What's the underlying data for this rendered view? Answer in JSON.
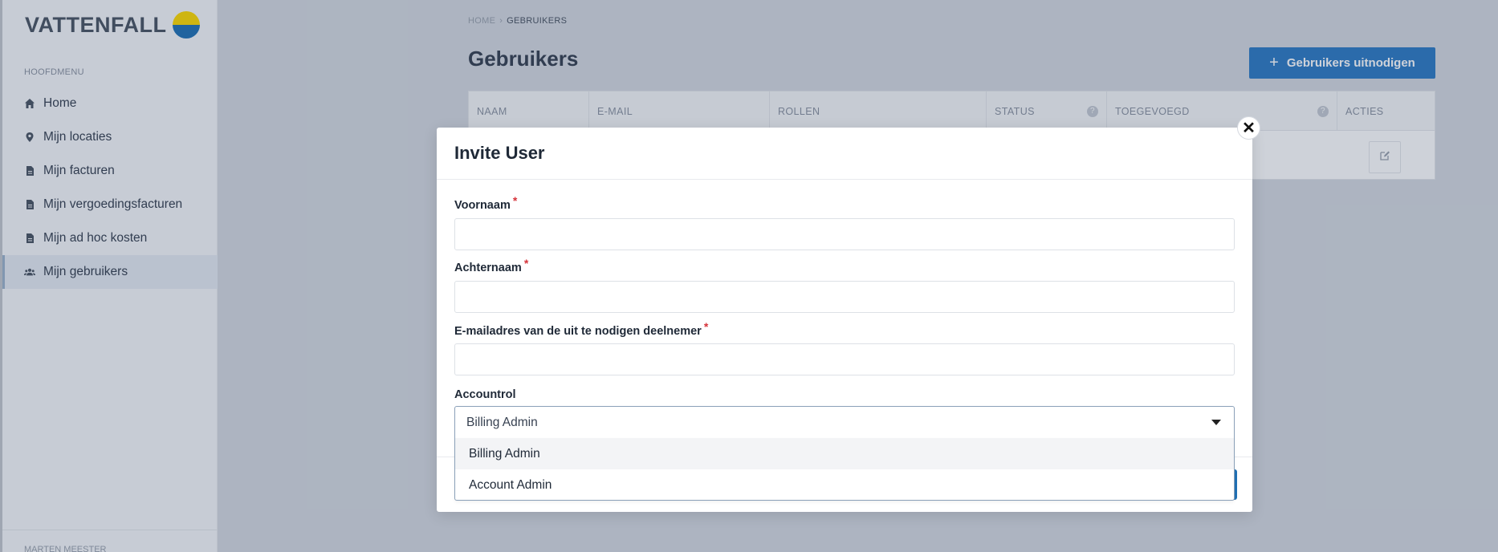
{
  "brand": {
    "name": "VATTENFALL"
  },
  "sidebar": {
    "section_title": "HOOFDMENU",
    "items": [
      {
        "label": "Home",
        "icon": "home-icon",
        "active": false
      },
      {
        "label": "Mijn locaties",
        "icon": "map-pin-icon",
        "active": false
      },
      {
        "label": "Mijn facturen",
        "icon": "document-icon",
        "active": false
      },
      {
        "label": "Mijn vergoedingsfacturen",
        "icon": "document-icon",
        "active": false
      },
      {
        "label": "Mijn ad hoc kosten",
        "icon": "document-icon",
        "active": false
      },
      {
        "label": "Mijn gebruikers",
        "icon": "users-icon",
        "active": true
      }
    ],
    "footer_user": "MARTEN MEESTER"
  },
  "breadcrumb": {
    "home": "HOME",
    "current": "GEBRUIKERS"
  },
  "page": {
    "title": "Gebruikers",
    "invite_button": "Gebruikers uitnodigen"
  },
  "table": {
    "columns": [
      "NAAM",
      "E-MAIL",
      "ROLLEN",
      "STATUS",
      "TOEGEVOEGD",
      "ACTIES"
    ]
  },
  "modal": {
    "title": "Invite User",
    "fields": {
      "first_name": {
        "label": "Voornaam",
        "required_mark": "*",
        "value": ""
      },
      "last_name": {
        "label": "Achternaam",
        "required_mark": "*",
        "value": ""
      },
      "email": {
        "label": "E-mailadres van de uit te nodigen deelnemer",
        "required_mark": "*",
        "value": ""
      },
      "role": {
        "label": "Accountrol",
        "selected": "Billing Admin",
        "options": [
          "Billing Admin",
          "Account Admin"
        ]
      }
    }
  },
  "colors": {
    "accent": "#2071b5",
    "required": "#d6333a",
    "logo_yellow": "#ffda00",
    "logo_blue": "#2071b5"
  }
}
